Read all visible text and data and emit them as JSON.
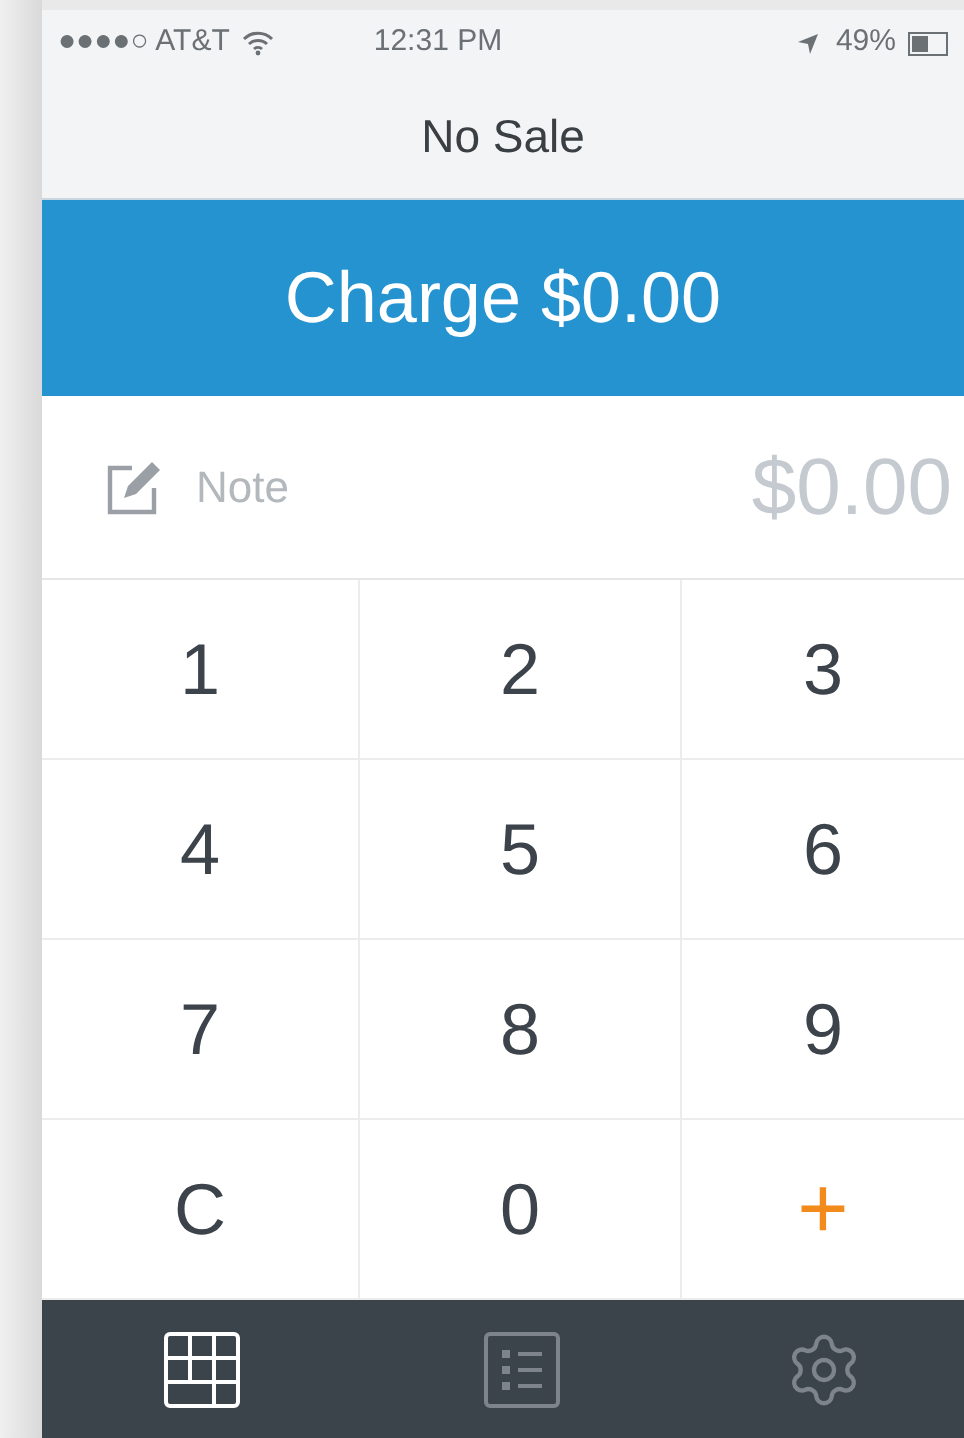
{
  "status_bar": {
    "carrier": "●●●●○ AT&T",
    "time": "12:31 PM",
    "battery": "49%"
  },
  "nav": {
    "title": "No Sale"
  },
  "charge_button": {
    "label": "Charge $0.00"
  },
  "note": {
    "placeholder": "Note",
    "amount": "$0.00"
  },
  "keypad": [
    {
      "label": "1",
      "kind": "digit"
    },
    {
      "label": "2",
      "kind": "digit"
    },
    {
      "label": "3",
      "kind": "digit"
    },
    {
      "label": "4",
      "kind": "digit"
    },
    {
      "label": "5",
      "kind": "digit"
    },
    {
      "label": "6",
      "kind": "digit"
    },
    {
      "label": "7",
      "kind": "digit"
    },
    {
      "label": "8",
      "kind": "digit"
    },
    {
      "label": "9",
      "kind": "digit"
    },
    {
      "label": "C",
      "kind": "clear"
    },
    {
      "label": "0",
      "kind": "digit"
    },
    {
      "label": "+",
      "kind": "add"
    }
  ],
  "tab_bar": [
    {
      "kind": "keypad",
      "selected": true
    },
    {
      "kind": "library",
      "selected": false
    },
    {
      "kind": "settings",
      "selected": false
    }
  ]
}
